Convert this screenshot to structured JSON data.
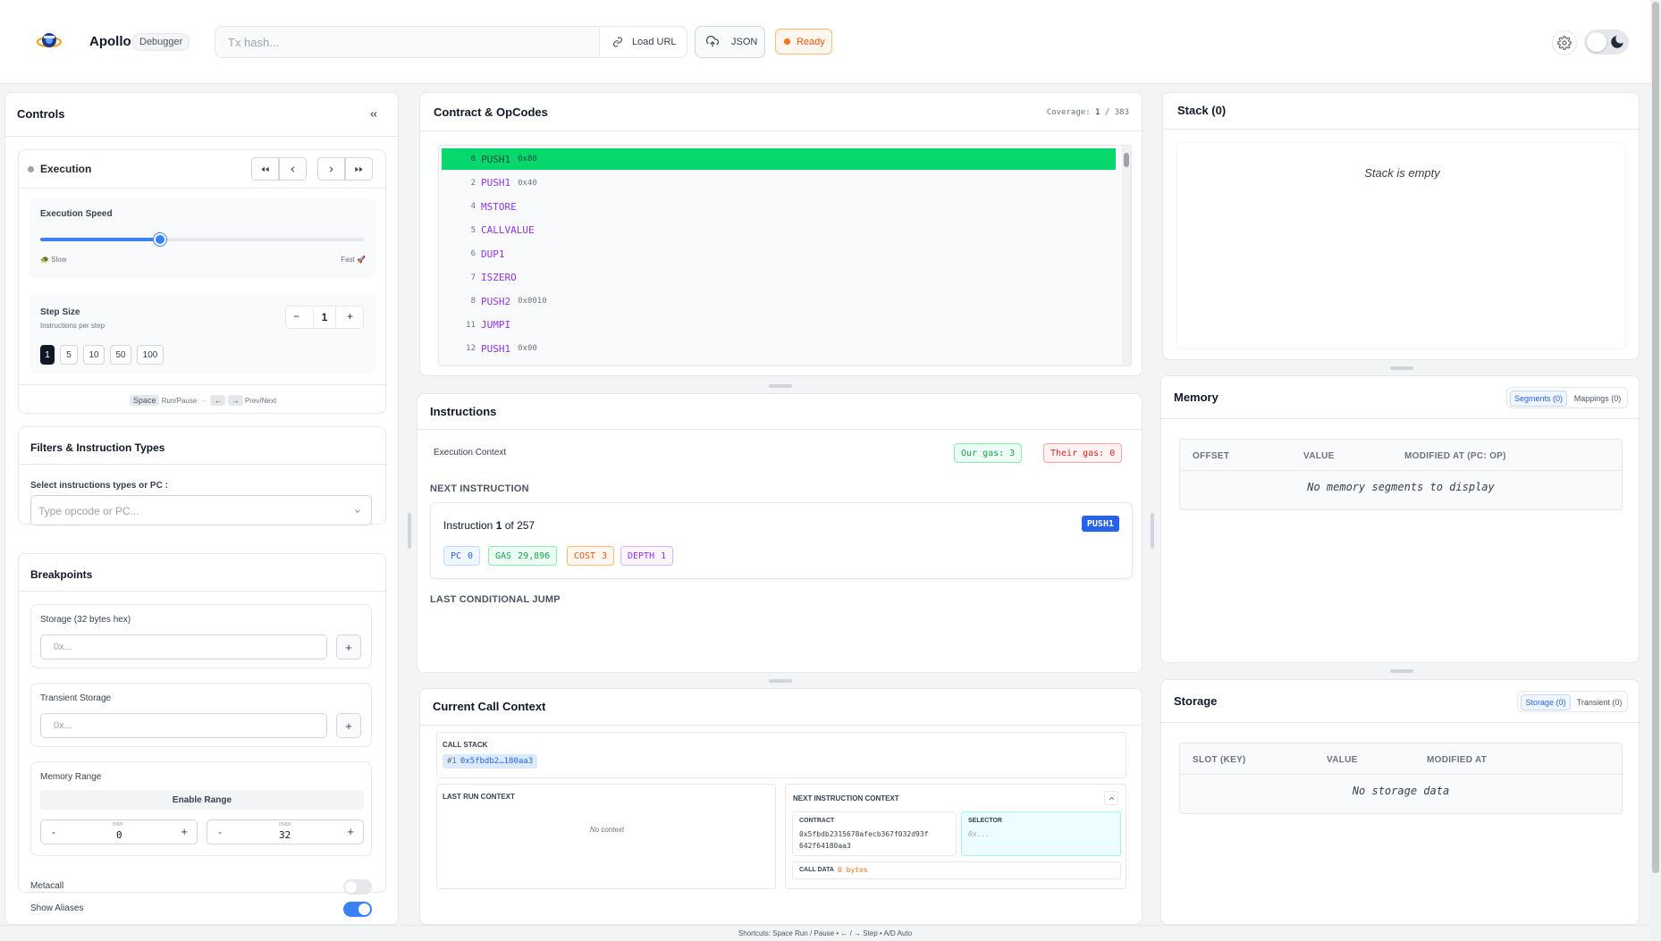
{
  "header": {
    "app_name": "Apollo",
    "app_badge": "Debugger",
    "tx_placeholder": "Tx hash...",
    "load_url_label": "Load URL",
    "json_label": "JSON",
    "status_label": "Ready"
  },
  "controls": {
    "title": "Controls",
    "execution": {
      "title": "Execution",
      "speed_label": "Execution Speed",
      "speed_fraction": 0.37,
      "slow_label": "🐢 Slow",
      "fast_label": "Fast 🚀",
      "step_size_label": "Step Size",
      "step_size_sub": "Instructions per step",
      "step_size_value": "1",
      "step_minus": "−",
      "step_plus": "+",
      "step_presets": [
        "1",
        "5",
        "10",
        "50",
        "100"
      ],
      "shortcut_space": "Space",
      "shortcut_run_pause": "Run/Pause",
      "shortcut_sep": "·",
      "shortcut_left": "←",
      "shortcut_right": "→",
      "shortcut_prev_next": "Prev/Next"
    },
    "filters": {
      "title": "Filters & Instruction Types",
      "select_label": "Select instructions types or PC :",
      "select_placeholder": "Type opcode or PC..."
    },
    "breakpoints": {
      "title": "Breakpoints",
      "storage_label": "Storage (32 bytes hex)",
      "storage_placeholder": "0x...",
      "transient_label": "Transient Storage",
      "transient_placeholder": "0x...",
      "add_label": "+",
      "memory_range_label": "Memory Range",
      "enable_range_label": "Enable Range",
      "min_label": "min",
      "min_value": "0",
      "max_label": "max",
      "max_value": "32",
      "dec_label": "-",
      "inc_label": "+"
    },
    "metacall_label": "Metacall",
    "show_aliases_label": "Show Aliases"
  },
  "contract": {
    "title": "Contract & OpCodes",
    "coverage_label": "Coverage:",
    "coverage_value": "1",
    "coverage_sep": "/",
    "coverage_total": "383",
    "opcodes": [
      {
        "pc": "0",
        "name": "PUSH1",
        "arg": "0x80"
      },
      {
        "pc": "2",
        "name": "PUSH1",
        "arg": "0x40"
      },
      {
        "pc": "4",
        "name": "MSTORE",
        "arg": ""
      },
      {
        "pc": "5",
        "name": "CALLVALUE",
        "arg": ""
      },
      {
        "pc": "6",
        "name": "DUP1",
        "arg": ""
      },
      {
        "pc": "7",
        "name": "ISZERO",
        "arg": ""
      },
      {
        "pc": "8",
        "name": "PUSH2",
        "arg": "0x0010"
      },
      {
        "pc": "11",
        "name": "JUMPI",
        "arg": ""
      },
      {
        "pc": "12",
        "name": "PUSH1",
        "arg": "0x00"
      }
    ]
  },
  "instructions": {
    "title": "Instructions",
    "exec_context_label": "Execution Context",
    "our_gas": "Our gas: 3",
    "their_gas": "Their gas: 0",
    "next_instruction_heading": "NEXT INSTRUCTION",
    "instruction_prefix": "Instruction",
    "instruction_index": "1",
    "instruction_suffix": "of 257",
    "opcode_badge": "PUSH1",
    "pc_label": "PC",
    "pc_value": "0",
    "gas_label": "GAS",
    "gas_value": "29,896",
    "cost_label": "COST",
    "cost_value": "3",
    "depth_label": "DEPTH",
    "depth_value": "1",
    "last_jump_heading": "LAST CONDITIONAL JUMP"
  },
  "call_context": {
    "title": "Current Call Context",
    "call_stack_label": "CALL STACK",
    "call_stack_index": "#1",
    "call_stack_addr": "0x5fbdb2…180aa3",
    "last_run_label": "LAST RUN CONTEXT",
    "no_context": "No context",
    "next_ctx_label": "NEXT INSTRUCTION CONTEXT",
    "contract_label": "CONTRACT",
    "contract_value_1": "0x5fbdb2315678afecb367f032d93f",
    "contract_value_2": "642f64180aa3",
    "selector_label": "SELECTOR",
    "selector_placeholder": "0x...",
    "calldata_label": "CALL DATA",
    "calldata_value": "0 bytes"
  },
  "stack": {
    "title": "Stack (0)",
    "empty": "Stack is empty"
  },
  "memory": {
    "title": "Memory",
    "tab_segments": "Segments (0)",
    "tab_mappings": "Mappings (0)",
    "col_offset": "OFFSET",
    "col_value": "VALUE",
    "col_modified": "MODIFIED AT (PC: OP)",
    "empty": "No memory segments to display"
  },
  "storage": {
    "title": "Storage",
    "tab_storage": "Storage (0)",
    "tab_transient": "Transient (0)",
    "col_slot": "SLOT (KEY)",
    "col_value": "VALUE",
    "col_modified": "MODIFIED AT",
    "empty": "No storage data"
  },
  "footer": {
    "shortcuts": "Shortcuts: Space Run / Pause • ← / → Step • A/D Auto"
  },
  "colors": {
    "accent": "#2563eb",
    "active_row": "#07d86b",
    "opcode": "#9333ea",
    "status": "#f97316"
  }
}
